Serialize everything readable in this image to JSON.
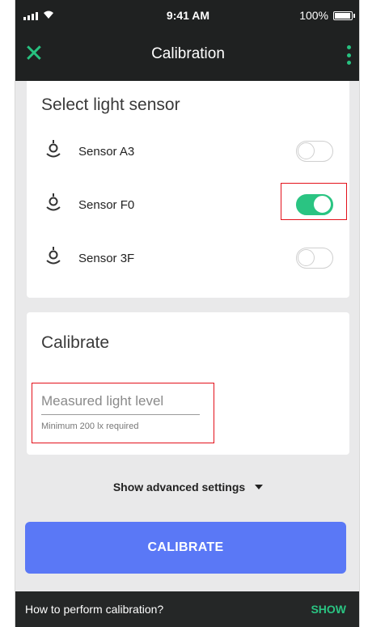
{
  "status_bar": {
    "time": "9:41 AM",
    "battery_text": "100%",
    "battery_level": 1.0
  },
  "app_bar": {
    "title": "Calibration",
    "close_icon": "close-icon",
    "menu_icon": "more-vert-icon"
  },
  "sensor_card": {
    "title": "Select light sensor",
    "sensors": [
      {
        "label": "Sensor A3",
        "on": false
      },
      {
        "label": "Sensor F0",
        "on": true
      },
      {
        "label": "Sensor 3F",
        "on": false
      }
    ]
  },
  "calibrate_card": {
    "title": "Calibrate",
    "field": {
      "placeholder": "Measured light level",
      "value": "",
      "helper": "Minimum 200 lx required"
    }
  },
  "advanced_label": "Show advanced settings",
  "calibrate_button": "CALIBRATE",
  "snackbar": {
    "text": "How to perform calibration?",
    "action": "SHOW"
  },
  "colors": {
    "accent_green": "#2ac482",
    "primary_blue": "#5a78f6",
    "dark_bar": "#1f2121",
    "highlight_red": "#e3111b"
  }
}
